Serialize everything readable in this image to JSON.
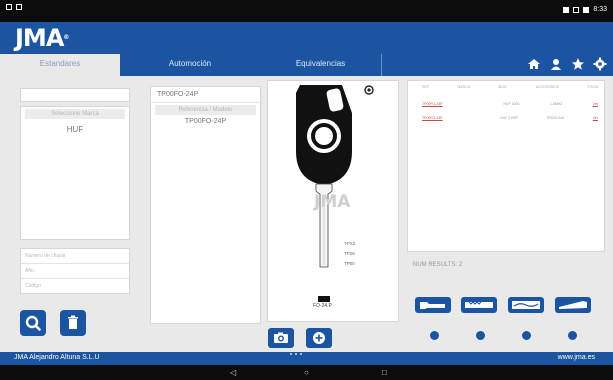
{
  "status": {
    "right_text": "8:33"
  },
  "app": {
    "logo_text": "JMA"
  },
  "tabs": [
    {
      "label": "Estandares",
      "active": true
    },
    {
      "label": "Automoción",
      "active": false
    },
    {
      "label": "Equivalencias",
      "active": false
    }
  ],
  "header_icons": [
    "home-icon",
    "user-icon",
    "star-icon",
    "gear-icon"
  ],
  "brands": {
    "search_value": "",
    "header": "Seleccione Marca",
    "items": [
      "HUF"
    ]
  },
  "refs": {
    "selected": "TP00FO-24P",
    "header": "Referencia / Modelo",
    "items": [
      "TP00FO-24P"
    ]
  },
  "fields": [
    "Numero de chasis",
    "Año",
    "Código"
  ],
  "key": {
    "brand_watermark": "JMA",
    "labels": [
      "TPX2",
      "TP26",
      "TP00"
    ],
    "code": "FO-24.P"
  },
  "results": {
    "headers": [
      "REF",
      "MARCA",
      "MOD.",
      "ACCESORIOS",
      "FICHA"
    ],
    "rows": [
      {
        "ref": "TP00FO-24P",
        "col2": "",
        "col3": "HUF 3005",
        "col4": "1.8MHZ",
        "link": "Ver"
      },
      {
        "ref": "TP00FO-24P",
        "col2": "",
        "col3": "HUF 3 REF",
        "col4": "PROG.INA",
        "link": "Ver"
      }
    ],
    "count_label": "NUM RESULTS: 2"
  },
  "footer": {
    "company": "JMA Alejandro Altuna S.L.U",
    "website": "www.jma.es"
  },
  "colors": {
    "brand_blue": "#1b55a1",
    "background": "#e9e9ea",
    "statusbar": "#0c0c0c"
  }
}
